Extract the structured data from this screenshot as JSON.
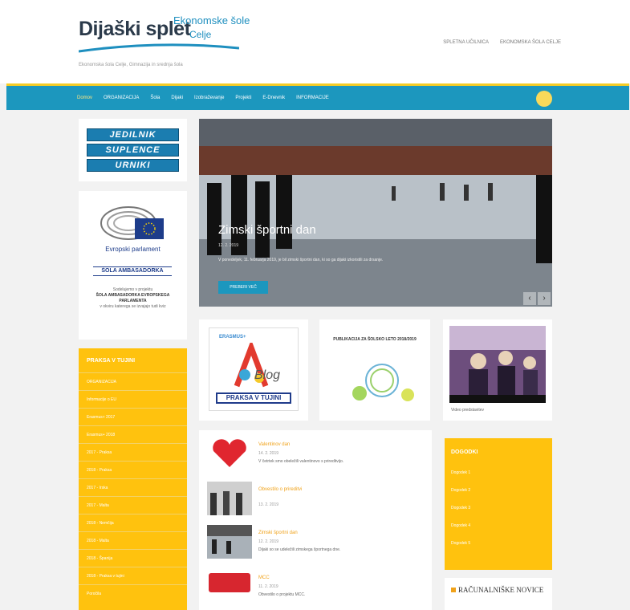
{
  "header": {
    "logo_main": "Dijaški splet",
    "logo_sub1": "Ekonomske šole",
    "logo_sub2": "Celje",
    "tagline": "Ekonomska šola Celje, Gimnazija in srednja šola",
    "top_links": [
      "SPLETNA UČILNICA",
      "EKONOMSKA ŠOLA CELJE"
    ]
  },
  "nav": {
    "items": [
      "Domov",
      "ORGANIZACIJA",
      "Šola",
      "Dijaki",
      "Izobraževanje",
      "Projekti",
      "E-Dnevnik",
      "INFORMACIJE"
    ]
  },
  "left": {
    "menu_buttons": [
      "JEDILNIK",
      "SUPLENCE",
      "URNIKI"
    ],
    "ep_name": "Evropski parlament",
    "ep_ambasador": "ŠOLA AMBASADORKA",
    "ep_text_1": "Sodelujemo v projektu",
    "ep_text_2": "ŠOLA AMBASADORKA EVROPSKEGA PARLAMENTA",
    "ep_text_3": "v okviru katerega se izvajajo tudi kviz",
    "yellow_title": "PRAKSA V TUJINI",
    "side_items": [
      "ORGANIZACIJA",
      "Informacije o EU",
      "Erasmus+ 2017",
      "Erasmus+ 2018",
      "2017 - Praksa",
      "2018 - Praksa",
      "2017 - Irska",
      "2017 - Malta",
      "2018 - Nemčija",
      "2018 - Malta",
      "2018 - Španija",
      "2018 - Praksa v tujini",
      "Poročila"
    ]
  },
  "slider": {
    "title": "Zimski športni dan",
    "meta": "12. 2. 2019",
    "text": "V ponedeljek, 11. februarja 2019, je bil zimski športni dan, ki so ga dijaki izkoristili za drsanje.",
    "button": "PREBERI VEČ",
    "prev": "‹",
    "next": "›"
  },
  "tiles": {
    "blog_erasmus": "ERASMUS+",
    "blog_word": "Blog",
    "blog_title": "PRAKSA V TUJINI",
    "t2_text": "PUBLIKACIJA ZA ŠOLSKO LETO 2018/2019",
    "video_caption": "Video predstavitev"
  },
  "news": [
    {
      "title": "Valentinov dan",
      "date": "14. 2. 2019",
      "text": "V četrtek smo obeležili valentinovo s prireditvijo."
    },
    {
      "title": "Obvestilo o prireditvi",
      "date": "13. 2. 2019",
      "text": ""
    },
    {
      "title": "Zimski športni dan",
      "date": "12. 2. 2019",
      "text": "Dijaki so se udeležili zimskega športnega dne."
    },
    {
      "title": "MCC",
      "date": "11. 2. 2019",
      "text": "Obvestilo o projektu MCC."
    }
  ],
  "right": {
    "dogodki_title": "DOGODKI",
    "dogodki_items": [
      "Dogodek 1",
      "Dogodek 2",
      "Dogodek 3",
      "Dogodek 4",
      "Dogodek 5"
    ],
    "rac_title": "RAČUNALNIŠKE NOVICE"
  },
  "colors": {
    "nav": "#1c97be",
    "accent_yellow": "#ffc20e",
    "news_title": "#f0a21a"
  }
}
